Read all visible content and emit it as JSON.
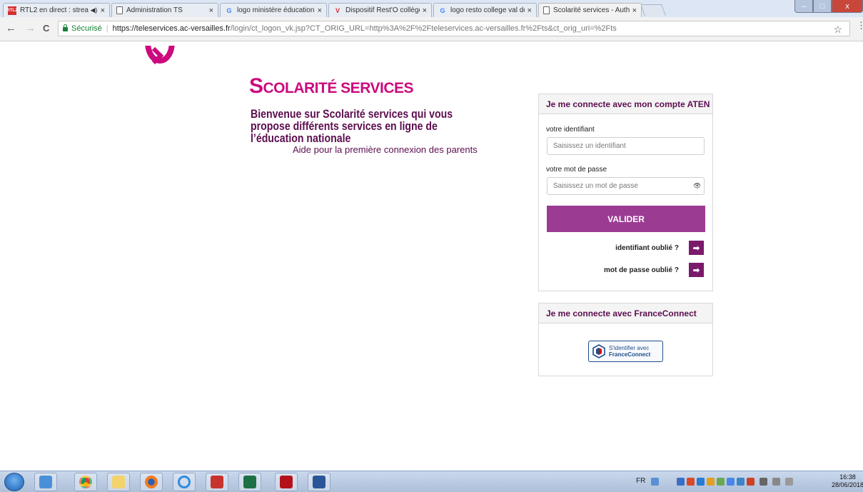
{
  "browser": {
    "tabs": [
      {
        "title": "RTL2 en direct : strea",
        "icon": "rtl2-icon",
        "audio": true
      },
      {
        "title": "Administration TS",
        "icon": "page-icon"
      },
      {
        "title": "logo ministère éducation",
        "icon": "google-icon"
      },
      {
        "title": "Dispositif Rest'O collège",
        "icon": "v-icon"
      },
      {
        "title": "logo resto college val do",
        "icon": "google-icon"
      },
      {
        "title": "Scolarité services - Authe",
        "icon": "page-icon",
        "active": true
      }
    ],
    "tab_close": "×",
    "secure_label": "Sécurisé",
    "url_host": "https://teleservices.ac-versailles.fr",
    "url_path": "/login/ct_logon_vk.jsp?CT_ORIG_URL=http%3A%2F%2Fteleservices.ac-versailles.fr%2Fts&ct_orig_uri=%2Fts",
    "back": "←",
    "forward": "→",
    "reload": "C",
    "star": "☆",
    "menu": "⋮",
    "min": "–",
    "max": "□",
    "close": "x"
  },
  "page": {
    "title_first": "S",
    "title_rest": "COLARITÉ SERVICES",
    "welcome": "Bienvenue sur Scolarité services qui vous propose différents services en ligne de l’éducation nationale",
    "help_link": "Aide pour la première connexion des parents"
  },
  "aten_panel": {
    "title": "Je me connecte avec mon compte ATEN",
    "id_label": "votre identifiant",
    "id_placeholder": "Saisissez un identifiant",
    "pwd_label": "votre mot de passe",
    "pwd_placeholder": "Saisissez un mot de passe",
    "eye": "👁",
    "submit": "VALIDER",
    "forgot_id": "identifiant oublié ?",
    "forgot_pwd": "mot de passe oublié ?",
    "arrow": "➡"
  },
  "fc_panel": {
    "title": "Je me connecte avec FranceConnect",
    "btn_line1": "S'identifier avec",
    "btn_line2": "FranceConnect"
  },
  "taskbar": {
    "lang": "FR",
    "time": "16:38",
    "date": "28/06/2018"
  },
  "colors": {
    "brand_pink": "#cc0a7d",
    "brand_plum": "#5c0e4f",
    "button_purple": "#9b3c92",
    "arrow_purple": "#7a1a6a"
  }
}
